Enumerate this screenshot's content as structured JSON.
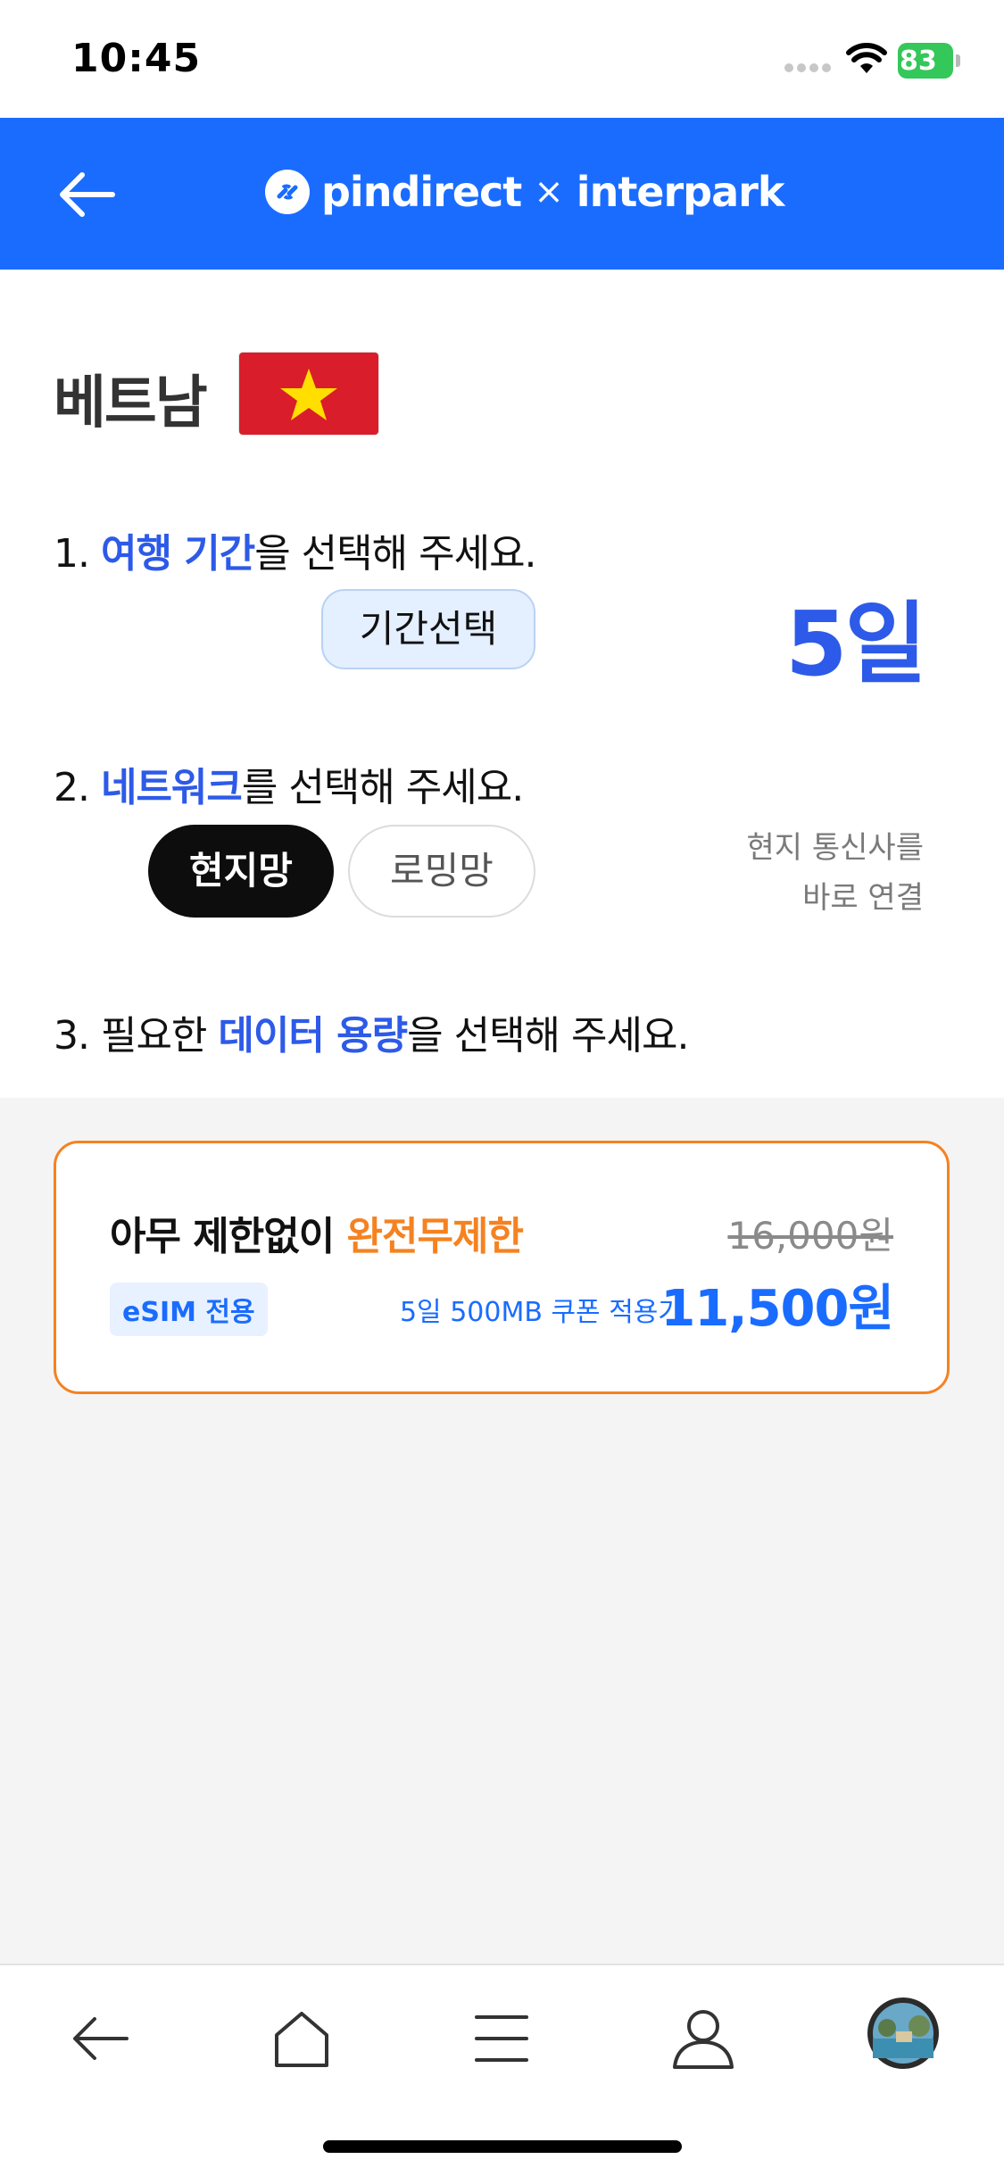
{
  "status_bar": {
    "time": "10:45",
    "battery": "83",
    "icons": [
      "signal-dots-icon",
      "wifi-icon",
      "battery-charging-icon"
    ]
  },
  "header": {
    "brand_left": "pindirect",
    "brand_sep": "×",
    "brand_right": "interpark",
    "accent": "#1a6cff"
  },
  "country": {
    "name": "베트남",
    "flag": "vietnam-flag-icon"
  },
  "step1": {
    "prefix": "1. ",
    "highlight": "여행 기간",
    "suffix": "을 선택해 주세요.",
    "button_label": "기간선택",
    "value": "5일"
  },
  "step2": {
    "prefix": "2. ",
    "highlight": "네트워크",
    "suffix": "를 선택해 주세요.",
    "options": [
      "현지망",
      "로밍망"
    ],
    "selected": "현지망",
    "description_line1": "현지 통신사를",
    "description_line2": "바로 연결"
  },
  "step3": {
    "prefix": "3. 필요한 ",
    "highlight": "데이터 용량",
    "suffix": "을 선택해 주세요."
  },
  "plan": {
    "name_prefix": "아무 제한없이 ",
    "name_highlight": "완전무제한",
    "original_price": "16,000원",
    "badge": "eSIM 전용",
    "coupon_label": "5일 500MB 쿠폰 적용가",
    "price": "11,500원",
    "accent": "#f58220"
  },
  "bottom_nav": {
    "items": [
      "back-icon",
      "home-icon",
      "menu-icon",
      "profile-icon",
      "avatar"
    ]
  }
}
